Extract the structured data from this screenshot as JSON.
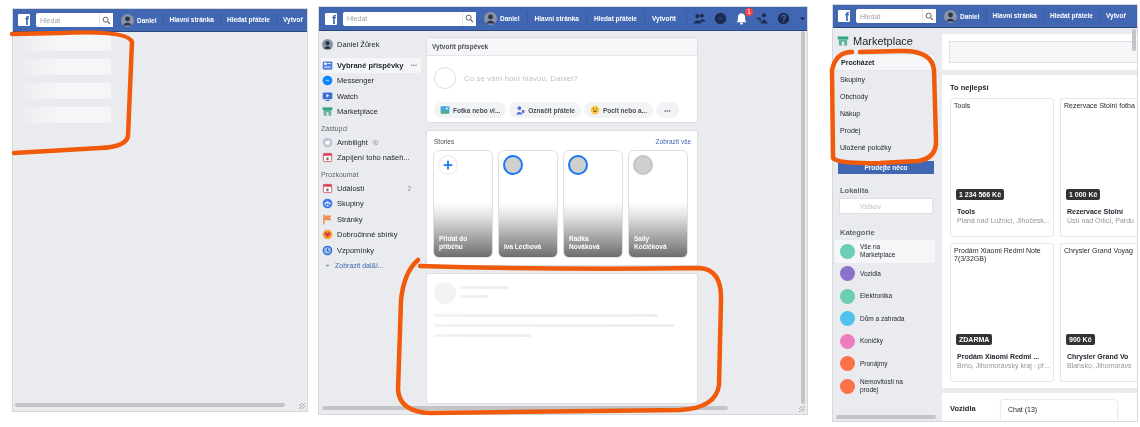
{
  "screens": [
    {
      "kind": "loading",
      "topbar": {
        "logo": "f",
        "search": {
          "placeholder": "Hledat"
        },
        "profile": "Daniel",
        "links": [
          "Hlavní stránka",
          "Hledat přátele",
          "Vytvoř"
        ]
      }
    },
    {
      "kind": "feed",
      "topbar": {
        "logo": "f",
        "search": {
          "placeholder": "Hledat"
        },
        "profile": "Daniel",
        "links": [
          "Hlavní stránka",
          "Hledat přátele",
          "Vytvořit"
        ],
        "notifications_badge": "1"
      },
      "sidebar": {
        "profile": "Daniel Žůrek",
        "sections": [
          {
            "items": [
              {
                "label": "Vybrané příspěvky",
                "selected": true,
                "more": "•••"
              },
              {
                "label": "Messenger",
                "selected": false
              },
              {
                "label": "Watch",
                "selected": false
              },
              {
                "label": "Marketplace",
                "selected": false
              }
            ]
          },
          {
            "heading": "Zástupci",
            "items": [
              {
                "label": "Ambilight",
                "selected": false
              },
              {
                "label": "Zapíjení toho našeh...",
                "selected": false
              }
            ]
          },
          {
            "heading": "Prozkoumat",
            "items": [
              {
                "label": "Události",
                "selected": false,
                "count": "2"
              },
              {
                "label": "Skupiny",
                "selected": false
              },
              {
                "label": "Stránky",
                "selected": false
              },
              {
                "label": "Dobročinné sbírky",
                "selected": false
              },
              {
                "label": "Vzpomínky",
                "selected": false
              }
            ]
          }
        ],
        "show_more": "Zobrazit dal&i..."
      },
      "composer": {
        "title": "Vytvořit příspěvek",
        "placeholder": "Co se vám honí hlavou, Daniel?",
        "actions": [
          "Fotka nebo vi...",
          "Označit přátele",
          "Pocit nebo a..."
        ],
        "more": "•••"
      },
      "stories": {
        "title": "Stories",
        "link": "Zobrazit vše",
        "items": [
          {
            "kind": "add",
            "label": "Přidat do příběhu"
          },
          {
            "kind": "story",
            "label": "Iva Lechová",
            "seen": false
          },
          {
            "kind": "story",
            "label": "Radka Nováková",
            "seen": false
          },
          {
            "kind": "story",
            "label": "Sally Kočičková",
            "seen": true
          }
        ]
      }
    },
    {
      "kind": "marketplace",
      "topbar": {
        "logo": "f",
        "search": {
          "placeholder": "Hledat"
        },
        "profile": "Daniel",
        "links": [
          "Hlavní stránka",
          "Hledat přátele",
          "Vytvoř"
        ]
      },
      "title": "Marketplace",
      "nav": [
        {
          "label": "Procházet",
          "selected": true
        },
        {
          "label": "Skupiny",
          "selected": false
        },
        {
          "label": "Obchody",
          "selected": false
        },
        {
          "label": "Nákup",
          "selected": false
        },
        {
          "label": "Prodej",
          "selected": false
        },
        {
          "label": "Uložené položky",
          "selected": false
        }
      ],
      "sell_button": "Prodejte něco",
      "location": {
        "label": "Lokalita",
        "placeholder": "Výškov"
      },
      "categories_title": "Kategorie",
      "categories": [
        {
          "label": "Vše na Marketplace",
          "color": "#6bcdb6",
          "selected": true
        },
        {
          "label": "Vozidla",
          "color": "#8c72cb",
          "selected": false
        },
        {
          "label": "Elektronika",
          "color": "#6bcdb6",
          "selected": false
        },
        {
          "label": "Dům a zahrada",
          "color": "#4fc3ed",
          "selected": false
        },
        {
          "label": "Koníčky",
          "color": "#ec7ebd",
          "selected": false
        },
        {
          "label": "Pronájmy",
          "color": "#fb724b",
          "selected": false
        },
        {
          "label": "Nemovitosti na prodej",
          "color": "#fb724b",
          "selected": false
        }
      ],
      "section_title": "To nejlepší",
      "listings": [
        {
          "image_alt": "Tools",
          "price": "1 234 566 Kč",
          "title": "Tools",
          "location": "Planá nad Lužnicí, Jihočesk..."
        },
        {
          "image_alt": "Rezervace Stolní fotba",
          "price": "1 000 Kč",
          "title": "Rezervace Stolní",
          "location": "Ústí nad Orlicí, Pardu"
        },
        {
          "image_alt": "Prodám Xiaomi Redmi Note 7(3/32GB)",
          "price": "ZDARMA",
          "title": "Prodám Xiaomi Redmi ...",
          "location": "Brno, Jihomoravský kraj · př..."
        },
        {
          "image_alt": "Chrysler Grand Voyag",
          "price": "900 Kč",
          "title": "Chrysler Grand Vo",
          "location": "Blansko, Jihomoravs"
        }
      ],
      "bottom_section": "Vozidla",
      "chat": "Chat (13)"
    }
  ]
}
